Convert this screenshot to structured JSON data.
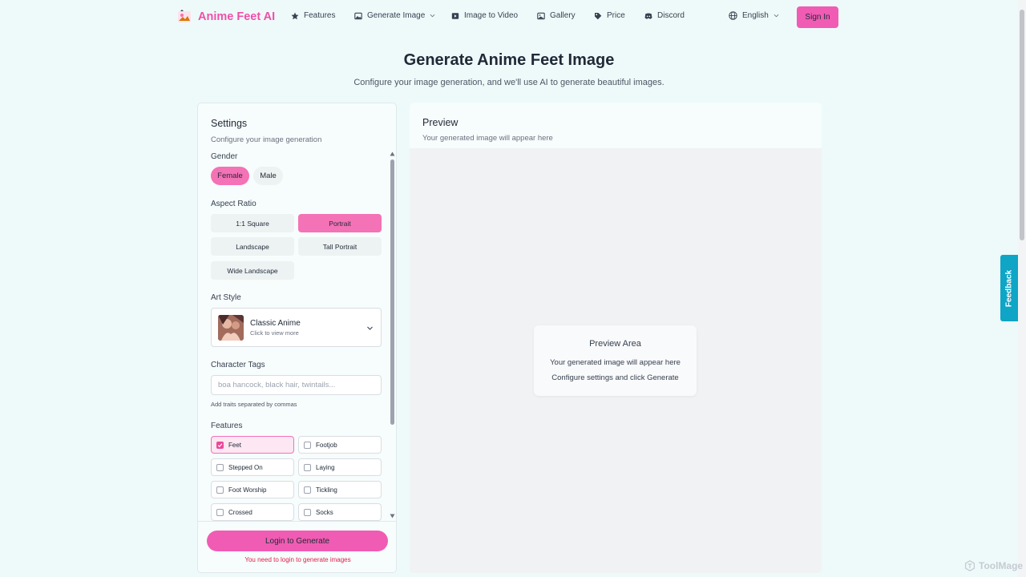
{
  "brand": {
    "name": "Anime Feet AI"
  },
  "nav": {
    "features": "Features",
    "generate_image": "Generate Image",
    "image_to_video": "Image to Video",
    "gallery": "Gallery",
    "price": "Price",
    "discord": "Discord",
    "language": "English",
    "sign_in": "Sign In"
  },
  "hero": {
    "title": "Generate Anime Feet Image",
    "subtitle": "Configure your image generation, and we'll use AI to generate beautiful images."
  },
  "settings": {
    "title": "Settings",
    "subtitle": "Configure your image generation",
    "gender": {
      "label": "Gender",
      "options": [
        "Female",
        "Male"
      ],
      "selected": "Female"
    },
    "aspect_ratio": {
      "label": "Aspect Ratio",
      "options": [
        "1:1 Square",
        "Portrait",
        "Landscape",
        "Tall Portrait",
        "Wide Landscape"
      ],
      "selected": "Portrait"
    },
    "art_style": {
      "label": "Art Style",
      "selected_name": "Classic Anime",
      "hint": "Click to view more"
    },
    "character_tags": {
      "label": "Character Tags",
      "placeholder": "boa hancock, black hair, twintails...",
      "help": "Add traits separated by commas"
    },
    "features": {
      "label": "Features",
      "items": [
        {
          "label": "Feet",
          "checked": true
        },
        {
          "label": "Footjob",
          "checked": false
        },
        {
          "label": "Stepped On",
          "checked": false
        },
        {
          "label": "Laying",
          "checked": false
        },
        {
          "label": "Foot Worship",
          "checked": false
        },
        {
          "label": "Tickling",
          "checked": false
        },
        {
          "label": "Crossed",
          "checked": false
        },
        {
          "label": "Socks",
          "checked": false
        }
      ]
    },
    "login_button": "Login to Generate",
    "login_note": "You need to login to generate images"
  },
  "preview": {
    "title": "Preview",
    "subtitle": "Your generated image will appear here",
    "card": {
      "title": "Preview Area",
      "line1": "Your generated image will appear here",
      "line2": "Configure settings and click Generate"
    }
  },
  "feedback": "Feedback",
  "watermark": "ToolMage",
  "colors": {
    "brand_pink": "#f050a8",
    "button_pink": "#f05cb3",
    "page_bg": "#eefafa",
    "feedback_bg": "#0ea5c6",
    "error_text": "#e11d48"
  }
}
